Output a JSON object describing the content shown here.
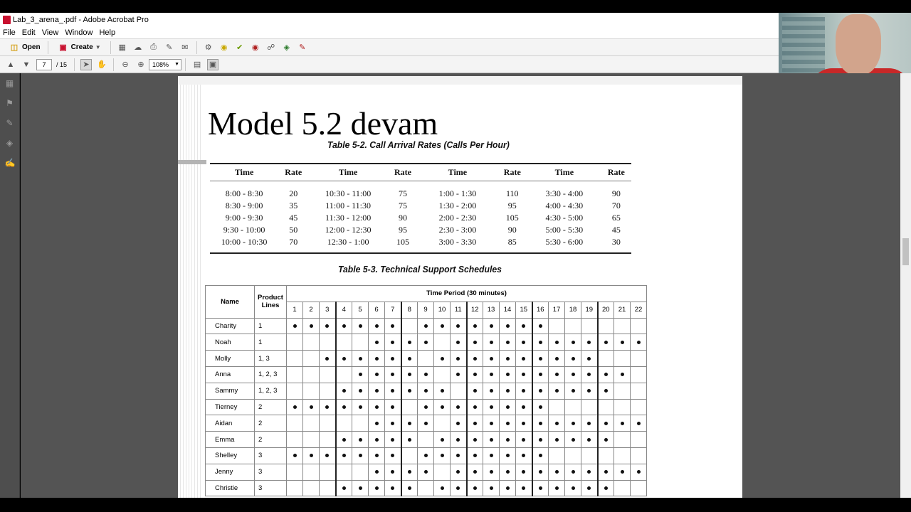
{
  "window": {
    "title": "Lab_3_arena_.pdf - Adobe Acrobat Pro"
  },
  "menu": [
    "File",
    "Edit",
    "View",
    "Window",
    "Help"
  ],
  "toolbar": {
    "open_label": "Open",
    "create_label": "Create"
  },
  "nav": {
    "page_current": "7",
    "page_total": "/ 15",
    "zoom": "108%"
  },
  "document": {
    "heading": "Model 5.2 devam",
    "table2": {
      "caption": "Table 5-2. Call Arrival Rates (Calls Per Hour)",
      "headers": [
        "Time",
        "Rate",
        "Time",
        "Rate",
        "Time",
        "Rate",
        "Time",
        "Rate"
      ],
      "rows": [
        [
          "8:00 - 8:30",
          "20",
          "10:30 - 11:00",
          "75",
          "1:00 - 1:30",
          "110",
          "3:30 - 4:00",
          "90"
        ],
        [
          "8:30 - 9:00",
          "35",
          "11:00 - 11:30",
          "75",
          "1:30 - 2:00",
          "95",
          "4:00 - 4:30",
          "70"
        ],
        [
          "9:00 - 9:30",
          "45",
          "11:30 - 12:00",
          "90",
          "2:00 - 2:30",
          "105",
          "4:30 - 5:00",
          "65"
        ],
        [
          "9:30 - 10:00",
          "50",
          "12:00 - 12:30",
          "95",
          "2:30 - 3:00",
          "90",
          "5:00 - 5:30",
          "45"
        ],
        [
          "10:00 - 10:30",
          "70",
          "12:30 - 1:00",
          "105",
          "3:00 - 3:30",
          "85",
          "5:30 - 6:00",
          "30"
        ]
      ]
    },
    "table3": {
      "caption": "Table 5-3. Technical Support Schedules",
      "col_name": "Name",
      "col_lines": "Product Lines",
      "col_period": "Time Period (30 minutes)",
      "periods": [
        "1",
        "2",
        "3",
        "4",
        "5",
        "6",
        "7",
        "8",
        "9",
        "10",
        "11",
        "12",
        "13",
        "14",
        "15",
        "16",
        "17",
        "18",
        "19",
        "20",
        "21",
        "22"
      ],
      "rows": [
        {
          "name": "Charity",
          "lines": "1",
          "dots": "1111111011111111000000"
        },
        {
          "name": "Noah",
          "lines": "1",
          "dots": "0000011110111111111111"
        },
        {
          "name": "Molly",
          "lines": "1, 3",
          "dots": "0011111101111111111000"
        },
        {
          "name": "Anna",
          "lines": "1, 2, 3",
          "dots": "0000111110111111111110"
        },
        {
          "name": "Sammy",
          "lines": "1, 2, 3",
          "dots": "0001111111011111111100"
        },
        {
          "name": "Tierney",
          "lines": "2",
          "dots": "1111111011111111000000"
        },
        {
          "name": "Aidan",
          "lines": "2",
          "dots": "0000011110111111111111"
        },
        {
          "name": "Emma",
          "lines": "2",
          "dots": "0001111101111111111100"
        },
        {
          "name": "Shelley",
          "lines": "3",
          "dots": "1111111011111111000000"
        },
        {
          "name": "Jenny",
          "lines": "3",
          "dots": "0000011110111111111111"
        },
        {
          "name": "Christie",
          "lines": "3",
          "dots": "0001111101111111111100"
        }
      ]
    }
  }
}
